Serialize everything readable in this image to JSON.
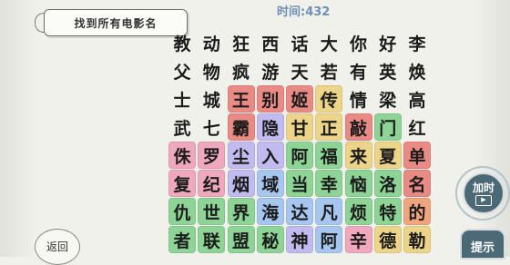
{
  "header": {
    "task_title": "找到所有电影名",
    "timer_text": "时间:432"
  },
  "buttons": {
    "add_time_label": "加时",
    "hint_label": "提示",
    "back_label": "返回"
  },
  "colors": {
    "red": "#e98a85",
    "green": "#8ed497",
    "yellow": "#ecd489",
    "purple": "#c2bbef",
    "pink": "#efa8be",
    "blue": "#a7c6ef",
    "orange": "#f0a57e"
  },
  "grid": [
    [
      {
        "ch": "教"
      },
      {
        "ch": "动"
      },
      {
        "ch": "狂"
      },
      {
        "ch": "西"
      },
      {
        "ch": "话"
      },
      {
        "ch": "大"
      },
      {
        "ch": "你"
      },
      {
        "ch": "好"
      },
      {
        "ch": "李"
      }
    ],
    [
      {
        "ch": "父"
      },
      {
        "ch": "物"
      },
      {
        "ch": "疯"
      },
      {
        "ch": "游"
      },
      {
        "ch": "天"
      },
      {
        "ch": "若"
      },
      {
        "ch": "有"
      },
      {
        "ch": "英"
      },
      {
        "ch": "焕"
      }
    ],
    [
      {
        "ch": "士"
      },
      {
        "ch": "城"
      },
      {
        "ch": "王",
        "c": "red"
      },
      {
        "ch": "别",
        "c": "red"
      },
      {
        "ch": "姬",
        "c": "red"
      },
      {
        "ch": "传",
        "c": "yellow"
      },
      {
        "ch": "情"
      },
      {
        "ch": "梁"
      },
      {
        "ch": "高"
      }
    ],
    [
      {
        "ch": "武"
      },
      {
        "ch": "七"
      },
      {
        "ch": "霸",
        "c": "red"
      },
      {
        "ch": "隐",
        "c": "purple"
      },
      {
        "ch": "甘",
        "c": "yellow"
      },
      {
        "ch": "正",
        "c": "yellow"
      },
      {
        "ch": "敲",
        "c": "red"
      },
      {
        "ch": "门",
        "c": "green"
      },
      {
        "ch": "红"
      }
    ],
    [
      {
        "ch": "侏",
        "c": "pink"
      },
      {
        "ch": "罗",
        "c": "pink"
      },
      {
        "ch": "尘",
        "c": "purple"
      },
      {
        "ch": "入",
        "c": "purple"
      },
      {
        "ch": "阿",
        "c": "green"
      },
      {
        "ch": "福",
        "c": "green"
      },
      {
        "ch": "来",
        "c": "yellow"
      },
      {
        "ch": "夏",
        "c": "yellow"
      },
      {
        "ch": "单",
        "c": "red"
      }
    ],
    [
      {
        "ch": "复",
        "c": "pink"
      },
      {
        "ch": "纪",
        "c": "pink"
      },
      {
        "ch": "烟",
        "c": "purple"
      },
      {
        "ch": "域",
        "c": "blue"
      },
      {
        "ch": "当",
        "c": "green"
      },
      {
        "ch": "幸",
        "c": "green"
      },
      {
        "ch": "恼",
        "c": "green"
      },
      {
        "ch": "洛",
        "c": "green"
      },
      {
        "ch": "名",
        "c": "red"
      }
    ],
    [
      {
        "ch": "仇",
        "c": "green"
      },
      {
        "ch": "世",
        "c": "green"
      },
      {
        "ch": "界",
        "c": "green"
      },
      {
        "ch": "海",
        "c": "blue"
      },
      {
        "ch": "达",
        "c": "blue"
      },
      {
        "ch": "凡",
        "c": "blue"
      },
      {
        "ch": "烦",
        "c": "green"
      },
      {
        "ch": "特",
        "c": "green"
      },
      {
        "ch": "的",
        "c": "orange"
      }
    ],
    [
      {
        "ch": "者",
        "c": "green"
      },
      {
        "ch": "联",
        "c": "green"
      },
      {
        "ch": "盟",
        "c": "green"
      },
      {
        "ch": "秘",
        "c": "green"
      },
      {
        "ch": "神",
        "c": "purple"
      },
      {
        "ch": "阿",
        "c": "blue"
      },
      {
        "ch": "辛",
        "c": "pink"
      },
      {
        "ch": "德",
        "c": "yellow"
      },
      {
        "ch": "勒",
        "c": "yellow"
      }
    ]
  ]
}
